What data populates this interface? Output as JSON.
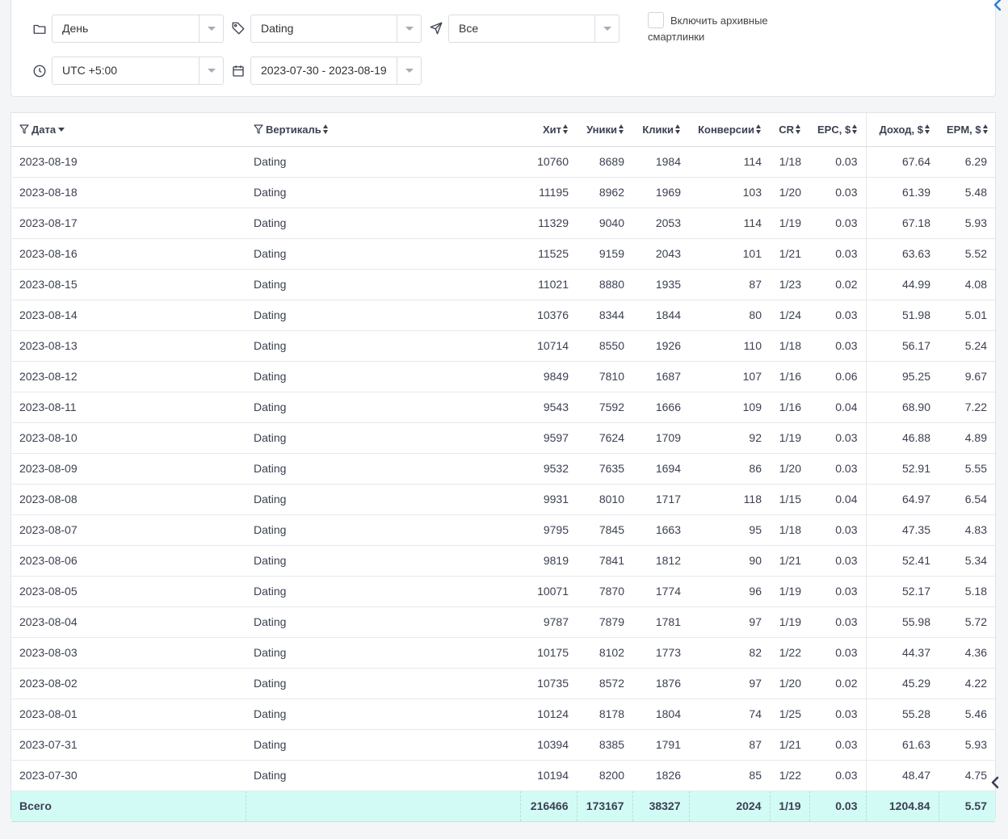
{
  "filters": {
    "grouping": "День",
    "vertical": "Dating",
    "source": "Все",
    "archive_label": "Включить архивные смартлинки",
    "timezone": "UTC +5:00",
    "date_range": "2023-07-30 - 2023-08-19"
  },
  "table": {
    "headers": {
      "date": "Дата",
      "vertical": "Вертикаль",
      "hits": "Хит",
      "uniques": "Уники",
      "clicks": "Клики",
      "conversions": "Конверсии",
      "cr": "CR",
      "epc": "EPC, $",
      "income": "Доход, $",
      "epm": "EPM, $"
    },
    "rows": [
      [
        "2023-08-19",
        "Dating",
        "10760",
        "8689",
        "1984",
        "114",
        "1/18",
        "0.03",
        "67.64",
        "6.29"
      ],
      [
        "2023-08-18",
        "Dating",
        "11195",
        "8962",
        "1969",
        "103",
        "1/20",
        "0.03",
        "61.39",
        "5.48"
      ],
      [
        "2023-08-17",
        "Dating",
        "11329",
        "9040",
        "2053",
        "114",
        "1/19",
        "0.03",
        "67.18",
        "5.93"
      ],
      [
        "2023-08-16",
        "Dating",
        "11525",
        "9159",
        "2043",
        "101",
        "1/21",
        "0.03",
        "63.63",
        "5.52"
      ],
      [
        "2023-08-15",
        "Dating",
        "11021",
        "8880",
        "1935",
        "87",
        "1/23",
        "0.02",
        "44.99",
        "4.08"
      ],
      [
        "2023-08-14",
        "Dating",
        "10376",
        "8344",
        "1844",
        "80",
        "1/24",
        "0.03",
        "51.98",
        "5.01"
      ],
      [
        "2023-08-13",
        "Dating",
        "10714",
        "8550",
        "1926",
        "110",
        "1/18",
        "0.03",
        "56.17",
        "5.24"
      ],
      [
        "2023-08-12",
        "Dating",
        "9849",
        "7810",
        "1687",
        "107",
        "1/16",
        "0.06",
        "95.25",
        "9.67"
      ],
      [
        "2023-08-11",
        "Dating",
        "9543",
        "7592",
        "1666",
        "109",
        "1/16",
        "0.04",
        "68.90",
        "7.22"
      ],
      [
        "2023-08-10",
        "Dating",
        "9597",
        "7624",
        "1709",
        "92",
        "1/19",
        "0.03",
        "46.88",
        "4.89"
      ],
      [
        "2023-08-09",
        "Dating",
        "9532",
        "7635",
        "1694",
        "86",
        "1/20",
        "0.03",
        "52.91",
        "5.55"
      ],
      [
        "2023-08-08",
        "Dating",
        "9931",
        "8010",
        "1717",
        "118",
        "1/15",
        "0.04",
        "64.97",
        "6.54"
      ],
      [
        "2023-08-07",
        "Dating",
        "9795",
        "7845",
        "1663",
        "95",
        "1/18",
        "0.03",
        "47.35",
        "4.83"
      ],
      [
        "2023-08-06",
        "Dating",
        "9819",
        "7841",
        "1812",
        "90",
        "1/21",
        "0.03",
        "52.41",
        "5.34"
      ],
      [
        "2023-08-05",
        "Dating",
        "10071",
        "7870",
        "1774",
        "96",
        "1/19",
        "0.03",
        "52.17",
        "5.18"
      ],
      [
        "2023-08-04",
        "Dating",
        "9787",
        "7879",
        "1781",
        "97",
        "1/19",
        "0.03",
        "55.98",
        "5.72"
      ],
      [
        "2023-08-03",
        "Dating",
        "10175",
        "8102",
        "1773",
        "82",
        "1/22",
        "0.03",
        "44.37",
        "4.36"
      ],
      [
        "2023-08-02",
        "Dating",
        "10735",
        "8572",
        "1876",
        "97",
        "1/20",
        "0.02",
        "45.29",
        "4.22"
      ],
      [
        "2023-08-01",
        "Dating",
        "10124",
        "8178",
        "1804",
        "74",
        "1/25",
        "0.03",
        "55.28",
        "5.46"
      ],
      [
        "2023-07-31",
        "Dating",
        "10394",
        "8385",
        "1791",
        "87",
        "1/21",
        "0.03",
        "61.63",
        "5.93"
      ],
      [
        "2023-07-30",
        "Dating",
        "10194",
        "8200",
        "1826",
        "85",
        "1/22",
        "0.03",
        "48.47",
        "4.75"
      ]
    ],
    "total": [
      "Всего",
      "",
      "216466",
      "173167",
      "38327",
      "2024",
      "1/19",
      "0.03",
      "1204.84",
      "5.57"
    ]
  },
  "icons": {
    "grouping": "folder-icon",
    "vertical": "tag-icon",
    "source": "send-icon",
    "timezone": "clock-icon",
    "date_range": "calendar-icon"
  },
  "colors": {
    "total_row": "#d3fbf6",
    "accent": "#2a7fd6"
  }
}
